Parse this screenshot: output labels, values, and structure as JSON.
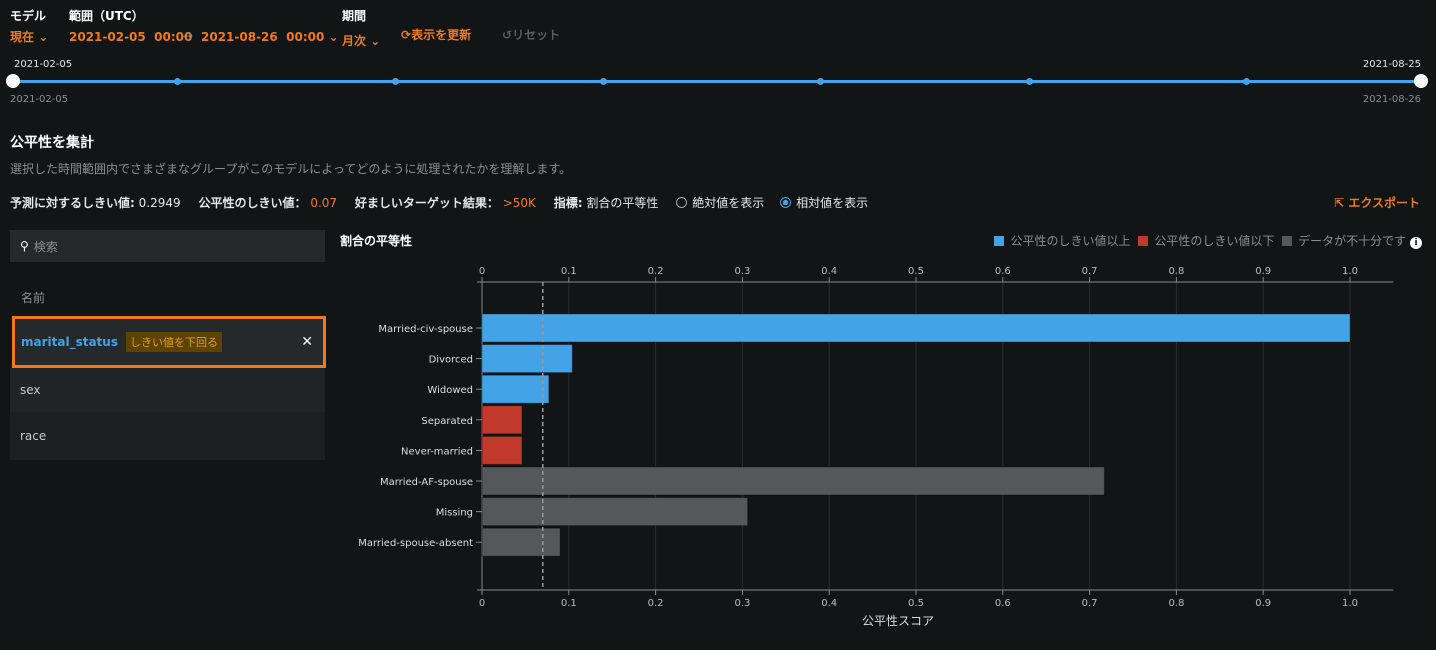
{
  "header": {
    "model_label": "モデル",
    "model_value": "現在",
    "range_label": "範囲（UTC）",
    "range_start": "2021-02-05  00:00",
    "range_end": "2021-08-26  00:00",
    "period_label": "期間",
    "period_value": "月次",
    "refresh": "表示を更新",
    "reset": "リセット"
  },
  "timeline": {
    "start_top": "2021-02-05",
    "end_top": "2021-08-25",
    "start_bottom": "2021-02-05",
    "end_bottom": "2021-08-26"
  },
  "section": {
    "title": "公平性を集計",
    "description": "選択した時間範囲内でさまざまなグループがこのモデルによってどのように処理されたかを理解します。"
  },
  "stats": {
    "pred_threshold_label": "予測に対するしきい値:",
    "pred_threshold": "0.2949",
    "fair_threshold_label": "公平性のしきい値：",
    "fair_threshold": "0.07",
    "target_label": "好ましいターゲット結果：",
    "target": ">50K",
    "metric_label": "指標:",
    "metric": "割合の平等性",
    "absolute": "絶対値を表示",
    "relative": "相対値を表示",
    "export": "エクスポート"
  },
  "sidebar": {
    "search_placeholder": "検索",
    "column": "名前",
    "items": [
      {
        "name": "marital_status",
        "badge": "しきい値を下回る"
      },
      {
        "name": "sex"
      },
      {
        "name": "race"
      }
    ]
  },
  "colors": {
    "above": "#43a3e6",
    "below": "#c0392b",
    "insufficient": "#54585b",
    "accent": "#f07a1a"
  },
  "chart_data": {
    "type": "bar",
    "orientation": "horizontal",
    "title": "割合の平等性",
    "xlabel": "公平性スコア",
    "xlim": [
      0,
      1.05
    ],
    "xticks": [
      0,
      0.1,
      0.2,
      0.3,
      0.4,
      0.5,
      0.6,
      0.7,
      0.8,
      0.9,
      1.0
    ],
    "threshold": 0.07,
    "legend": [
      {
        "label": "公平性のしきい値以上",
        "status": "above"
      },
      {
        "label": "公平性のしきい値以下",
        "status": "below"
      },
      {
        "label": "データが不十分です",
        "status": "insufficient"
      }
    ],
    "categories": [
      "Married-civ-spouse",
      "Divorced",
      "Widowed",
      "Separated",
      "Never-married",
      "Married-AF-spouse",
      "Missing",
      "Married-spouse-absent"
    ],
    "values": [
      1.0,
      0.104,
      0.077,
      0.046,
      0.046,
      0.717,
      0.306,
      0.09
    ],
    "status": [
      "above",
      "above",
      "above",
      "below",
      "below",
      "insufficient",
      "insufficient",
      "insufficient"
    ]
  }
}
